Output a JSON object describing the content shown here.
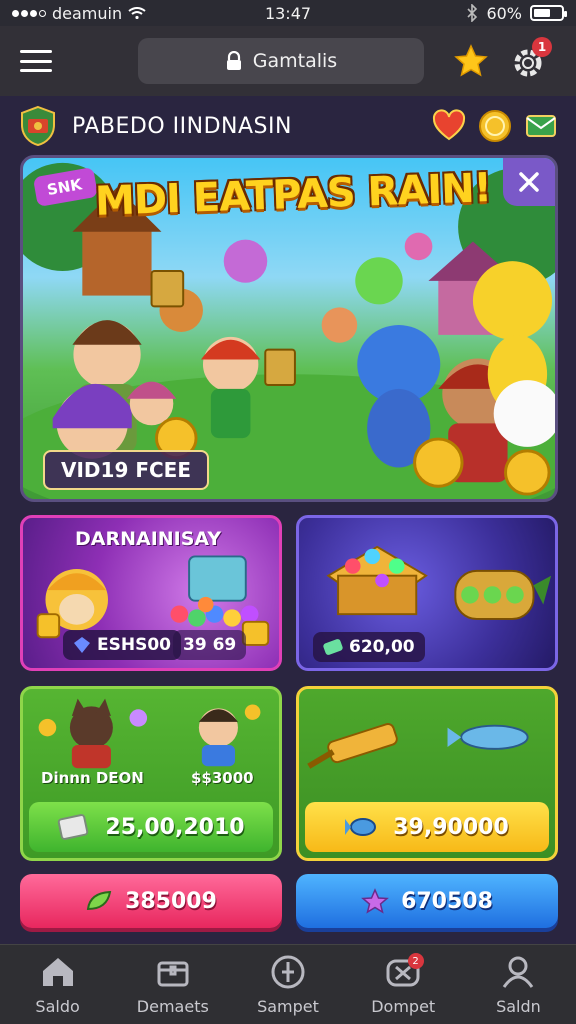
{
  "status_bar": {
    "carrier": "deamuin",
    "time": "13:47",
    "battery": "60%",
    "battery_level": 0.6
  },
  "header": {
    "search_label": "Gamtalis",
    "notification_count": "1"
  },
  "title_row": {
    "title": "PABEDO IINDNASIN"
  },
  "banner": {
    "badge": "SNK",
    "title": "MDI EATPAS RAIN!",
    "cta": "VID19 FCEE"
  },
  "cards": [
    {
      "title": "DARNAINISAY",
      "price": "ESHS00",
      "price2": "39 69"
    },
    {
      "title": "",
      "price": "620,00"
    },
    {
      "label_left": "Dinnn DEON",
      "label_right": "$$3000",
      "value": "25,00,2010"
    },
    {
      "value": "39,90000"
    }
  ],
  "buttons": {
    "pink": "385009",
    "blue": "670508"
  },
  "nav": [
    {
      "label": "Saldo",
      "icon": "home-icon"
    },
    {
      "label": "Demaets",
      "icon": "chest-icon"
    },
    {
      "label": "Sampet",
      "icon": "compass-icon"
    },
    {
      "label": "Dompet",
      "icon": "wallet-icon",
      "badge": "2"
    },
    {
      "label": "Saldn",
      "icon": "profile-icon"
    }
  ],
  "colors": {
    "accent_pink": "#e8275e",
    "accent_blue": "#1f6fe0",
    "accent_yellow": "#f7b918",
    "accent_green": "#3fb42e",
    "header_bg": "#323037"
  }
}
